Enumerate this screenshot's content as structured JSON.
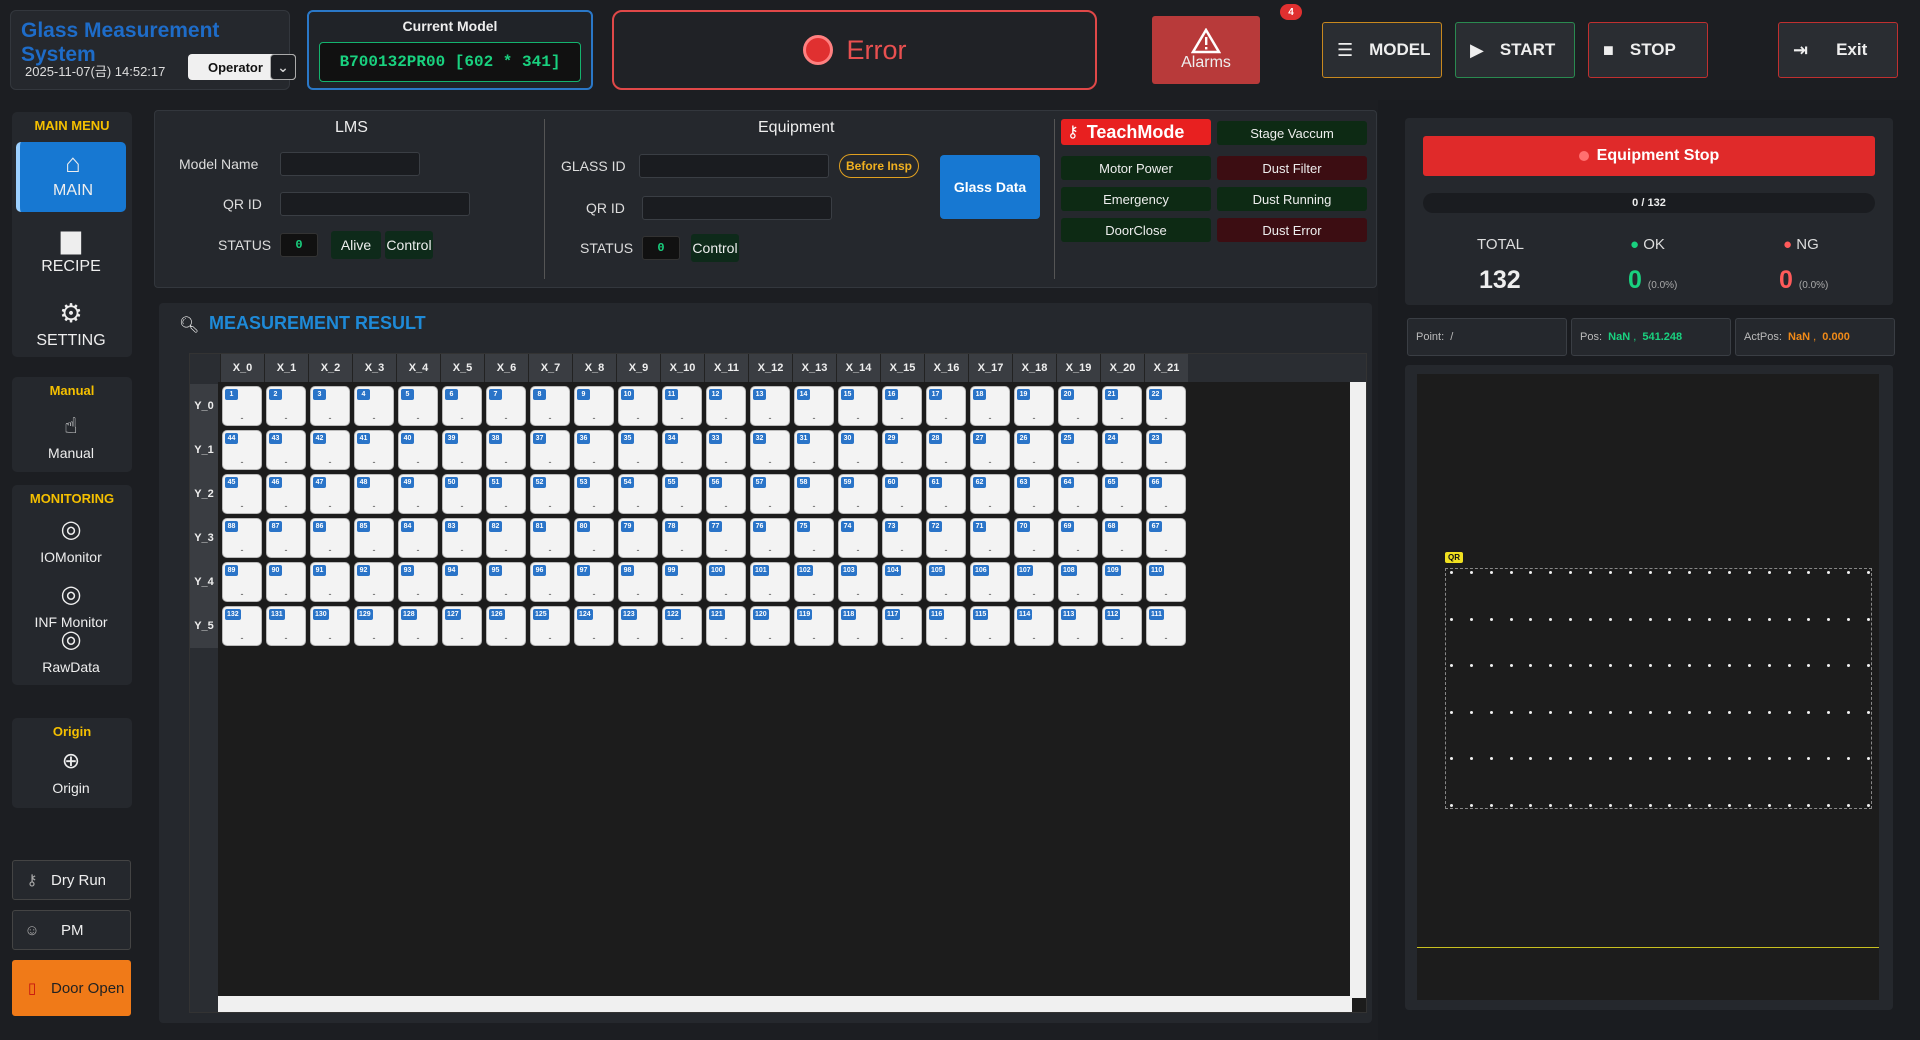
{
  "app": {
    "title": "Glass Measurement System",
    "datetime": "2025-11-07(금) 14:52:17",
    "user_role": "Operator"
  },
  "current_model": {
    "label": "Current Model",
    "value": "B700132PR00  [602 * 341]"
  },
  "error": {
    "text": "Error",
    "color": "#e03030"
  },
  "alarms": {
    "label": "Alarms",
    "count": "4",
    "icon": "warning-triangle-icon"
  },
  "toolbar": {
    "model": "MODEL",
    "start": "START",
    "stop": "STOP",
    "exit": "Exit"
  },
  "sidebar": {
    "main_menu": "MAIN MENU",
    "main": "MAIN",
    "recipe": "RECIPE",
    "setting": "SETTING",
    "manual_title": "Manual",
    "manual": "Manual",
    "monitoring_title": "MONITORING",
    "iomonitor": "IOMonitor",
    "inf_monitor": "INF Monitor",
    "rawdata": "RawData",
    "origin_title": "Origin",
    "origin": "Origin",
    "dry_run": "Dry Run",
    "pm": "PM",
    "door_open": "Door Open"
  },
  "lms": {
    "title": "LMS",
    "model_name_label": "Model Name",
    "model_name": "",
    "qr_id_label": "QR ID",
    "qr_id": "",
    "status_label": "STATUS",
    "status_value": "0",
    "alive": "Alive",
    "control": "Control"
  },
  "equipment": {
    "title": "Equipment",
    "glass_id_label": "GLASS ID",
    "glass_id": "",
    "before_insp": "Before Insp",
    "qr_id_label": "QR ID",
    "qr_id": "",
    "status_label": "STATUS",
    "status_value": "0",
    "control": "Control",
    "glass_data": "Glass Data"
  },
  "status_panel": {
    "teach_mode": "TeachMode",
    "items": [
      {
        "label": "Stage Vaccum",
        "state": "ok"
      },
      {
        "label": "Motor Power",
        "state": "ok"
      },
      {
        "label": "Dust Filter",
        "state": "alarm"
      },
      {
        "label": "Emergency",
        "state": "ok"
      },
      {
        "label": "Dust Running",
        "state": "ok"
      },
      {
        "label": "DoorClose",
        "state": "ok"
      },
      {
        "label": "Dust Error",
        "state": "alarm"
      }
    ]
  },
  "measurement": {
    "title": "MEASUREMENT RESULT",
    "columns": [
      "X_0",
      "X_1",
      "X_2",
      "X_3",
      "X_4",
      "X_5",
      "X_6",
      "X_7",
      "X_8",
      "X_9",
      "X_10",
      "X_11",
      "X_12",
      "X_13",
      "X_14",
      "X_15",
      "X_16",
      "X_17",
      "X_18",
      "X_19",
      "X_20",
      "X_21"
    ],
    "rows": [
      {
        "label": "Y_0",
        "cells": [
          1,
          2,
          3,
          4,
          5,
          6,
          7,
          8,
          9,
          10,
          11,
          12,
          13,
          14,
          15,
          16,
          17,
          18,
          19,
          20,
          21,
          22
        ]
      },
      {
        "label": "Y_1",
        "cells": [
          44,
          43,
          42,
          41,
          40,
          39,
          38,
          37,
          36,
          35,
          34,
          33,
          32,
          31,
          30,
          29,
          28,
          27,
          26,
          25,
          24,
          23
        ]
      },
      {
        "label": "Y_2",
        "cells": [
          45,
          46,
          47,
          48,
          49,
          50,
          51,
          52,
          53,
          54,
          55,
          56,
          57,
          58,
          59,
          60,
          61,
          62,
          63,
          64,
          65,
          66
        ]
      },
      {
        "label": "Y_3",
        "cells": [
          88,
          87,
          86,
          85,
          84,
          83,
          82,
          81,
          80,
          79,
          78,
          77,
          76,
          75,
          74,
          73,
          72,
          71,
          70,
          69,
          68,
          67
        ]
      },
      {
        "label": "Y_4",
        "cells": [
          89,
          90,
          91,
          92,
          93,
          94,
          95,
          96,
          97,
          98,
          99,
          100,
          101,
          102,
          103,
          104,
          105,
          106,
          107,
          108,
          109,
          110
        ]
      },
      {
        "label": "Y_5",
        "cells": [
          132,
          131,
          130,
          129,
          128,
          127,
          126,
          125,
          124,
          123,
          122,
          121,
          120,
          119,
          118,
          117,
          116,
          115,
          114,
          113,
          112,
          111
        ]
      }
    ],
    "cell_value": "-"
  },
  "counter": {
    "equipment_stop": "Equipment Stop",
    "progress_text": "0 / 132",
    "progress": 0,
    "total_label": "TOTAL",
    "total": "132",
    "ok_label": "OK",
    "ok": "0",
    "ok_pct": "(0.0%)",
    "ng_label": "NG",
    "ng": "0",
    "ng_pct": "(0.0%)"
  },
  "position": {
    "point_label": "Point:",
    "point": "/",
    "pos_label": "Pos:",
    "pos_x": "NaN",
    "pos_y": "541.248",
    "actpos_label": "ActPos:",
    "actpos_x": "NaN",
    "actpos_y": "0.000"
  },
  "glass_map": {
    "qr_label": "QR",
    "rows": 6,
    "cols": 22
  }
}
